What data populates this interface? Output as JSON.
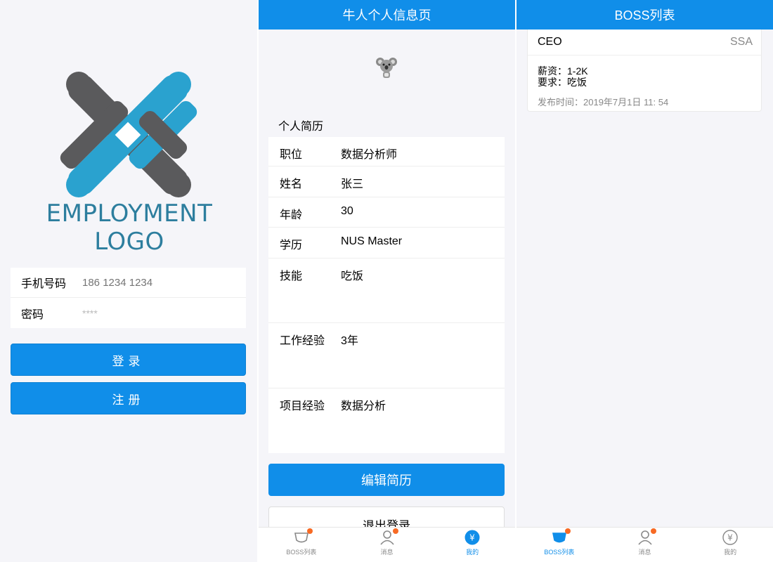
{
  "login": {
    "logo_text": "EMPLOYMENT LOGO",
    "phone_label": "手机号码",
    "phone_placeholder": "186 1234 1234",
    "password_label": "密码",
    "password_value": "****",
    "login_button": "登录",
    "register_button": "注册"
  },
  "profile": {
    "title": "牛人个人信息页",
    "section_title": "个人简历",
    "rows": [
      {
        "key": "职位",
        "value": "数据分析师"
      },
      {
        "key": "姓名",
        "value": "张三"
      },
      {
        "key": "年龄",
        "value": "30"
      },
      {
        "key": "学历",
        "value": "NUS Master"
      },
      {
        "key": "技能",
        "value": "吃饭"
      },
      {
        "key": "工作经验",
        "value": "3年"
      },
      {
        "key": "项目经验",
        "value": "数据分析"
      }
    ],
    "edit_button": "编辑简历",
    "logout_button": "退出登录"
  },
  "bosslist": {
    "title": "BOSS列表",
    "card": {
      "title": "CEO",
      "extra": "SSA",
      "salary": "薪资：1-2K",
      "requirement": "要求：吃饭",
      "published": "发布时间：2019年7月1日 11: 54"
    }
  },
  "tabbar": {
    "tab1": "BOSS列表",
    "tab2": "消息",
    "tab3": "我的"
  },
  "colors": {
    "primary": "#108ee9",
    "badge": "#f76a24",
    "logo_blue": "#2aa2cf",
    "logo_gray": "#5a5a5c"
  }
}
